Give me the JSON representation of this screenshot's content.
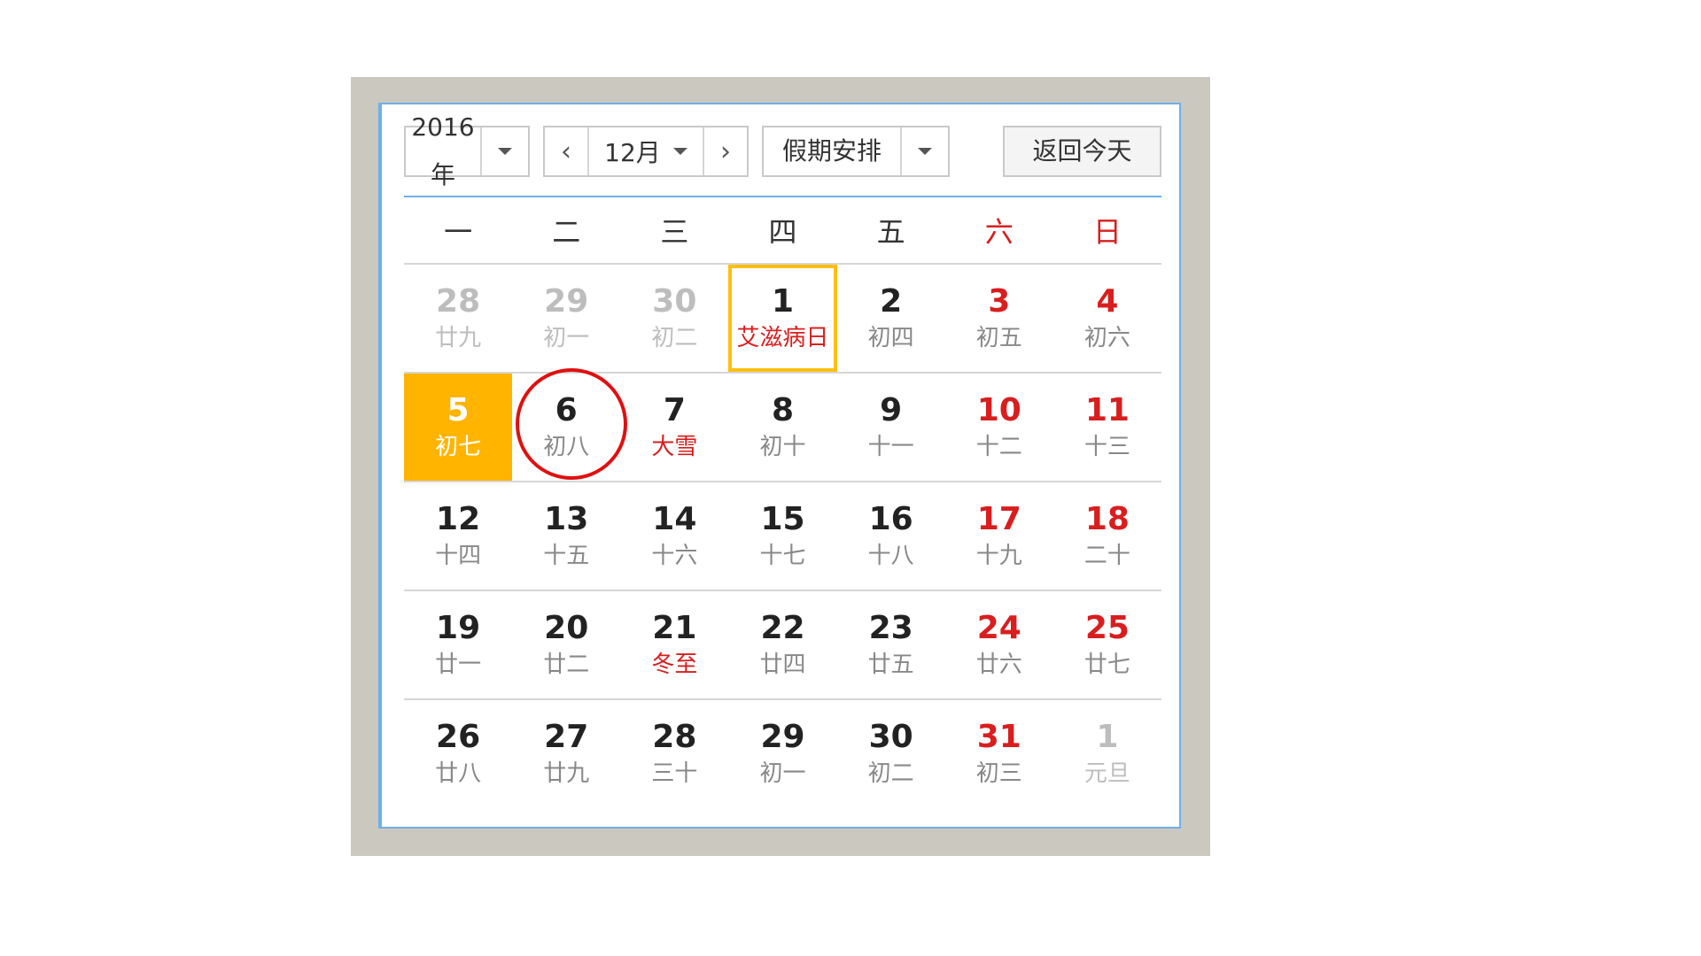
{
  "toolbar": {
    "year_label": "2016年",
    "month_label": "12月",
    "prev_arrow": "‹",
    "next_arrow": "›",
    "holiday_label": "假期安排",
    "today_button": "返回今天"
  },
  "weekdays": [
    "一",
    "二",
    "三",
    "四",
    "五",
    "六",
    "日"
  ],
  "weeks": [
    [
      {
        "day": "28",
        "lunar": "廿九",
        "state": "other"
      },
      {
        "day": "29",
        "lunar": "初一",
        "state": "other"
      },
      {
        "day": "30",
        "lunar": "初二",
        "state": "other"
      },
      {
        "day": "1",
        "lunar": "艾滋病日",
        "state": "selected festival"
      },
      {
        "day": "2",
        "lunar": "初四",
        "state": ""
      },
      {
        "day": "3",
        "lunar": "初五",
        "state": "weekend"
      },
      {
        "day": "4",
        "lunar": "初六",
        "state": "weekend"
      }
    ],
    [
      {
        "day": "5",
        "lunar": "初七",
        "state": "today"
      },
      {
        "day": "6",
        "lunar": "初八",
        "state": "circled"
      },
      {
        "day": "7",
        "lunar": "大雪",
        "state": "festival"
      },
      {
        "day": "8",
        "lunar": "初十",
        "state": ""
      },
      {
        "day": "9",
        "lunar": "十一",
        "state": ""
      },
      {
        "day": "10",
        "lunar": "十二",
        "state": "weekend"
      },
      {
        "day": "11",
        "lunar": "十三",
        "state": "weekend"
      }
    ],
    [
      {
        "day": "12",
        "lunar": "十四",
        "state": ""
      },
      {
        "day": "13",
        "lunar": "十五",
        "state": ""
      },
      {
        "day": "14",
        "lunar": "十六",
        "state": ""
      },
      {
        "day": "15",
        "lunar": "十七",
        "state": ""
      },
      {
        "day": "16",
        "lunar": "十八",
        "state": ""
      },
      {
        "day": "17",
        "lunar": "十九",
        "state": "weekend"
      },
      {
        "day": "18",
        "lunar": "二十",
        "state": "weekend"
      }
    ],
    [
      {
        "day": "19",
        "lunar": "廿一",
        "state": ""
      },
      {
        "day": "20",
        "lunar": "廿二",
        "state": ""
      },
      {
        "day": "21",
        "lunar": "冬至",
        "state": "festival"
      },
      {
        "day": "22",
        "lunar": "廿四",
        "state": ""
      },
      {
        "day": "23",
        "lunar": "廿五",
        "state": ""
      },
      {
        "day": "24",
        "lunar": "廿六",
        "state": "weekend"
      },
      {
        "day": "25",
        "lunar": "廿七",
        "state": "weekend"
      }
    ],
    [
      {
        "day": "26",
        "lunar": "廿八",
        "state": ""
      },
      {
        "day": "27",
        "lunar": "廿九",
        "state": ""
      },
      {
        "day": "28",
        "lunar": "三十",
        "state": ""
      },
      {
        "day": "29",
        "lunar": "初一",
        "state": ""
      },
      {
        "day": "30",
        "lunar": "初二",
        "state": ""
      },
      {
        "day": "31",
        "lunar": "初三",
        "state": "weekend"
      },
      {
        "day": "1",
        "lunar": "元旦",
        "state": "other"
      }
    ]
  ],
  "colors": {
    "accent_blue": "#6fb0e8",
    "weekend_red": "#d81e1e",
    "today_orange": "#ffb400",
    "selected_border": "#ffbe10",
    "annotation_circle": "#e01010"
  }
}
